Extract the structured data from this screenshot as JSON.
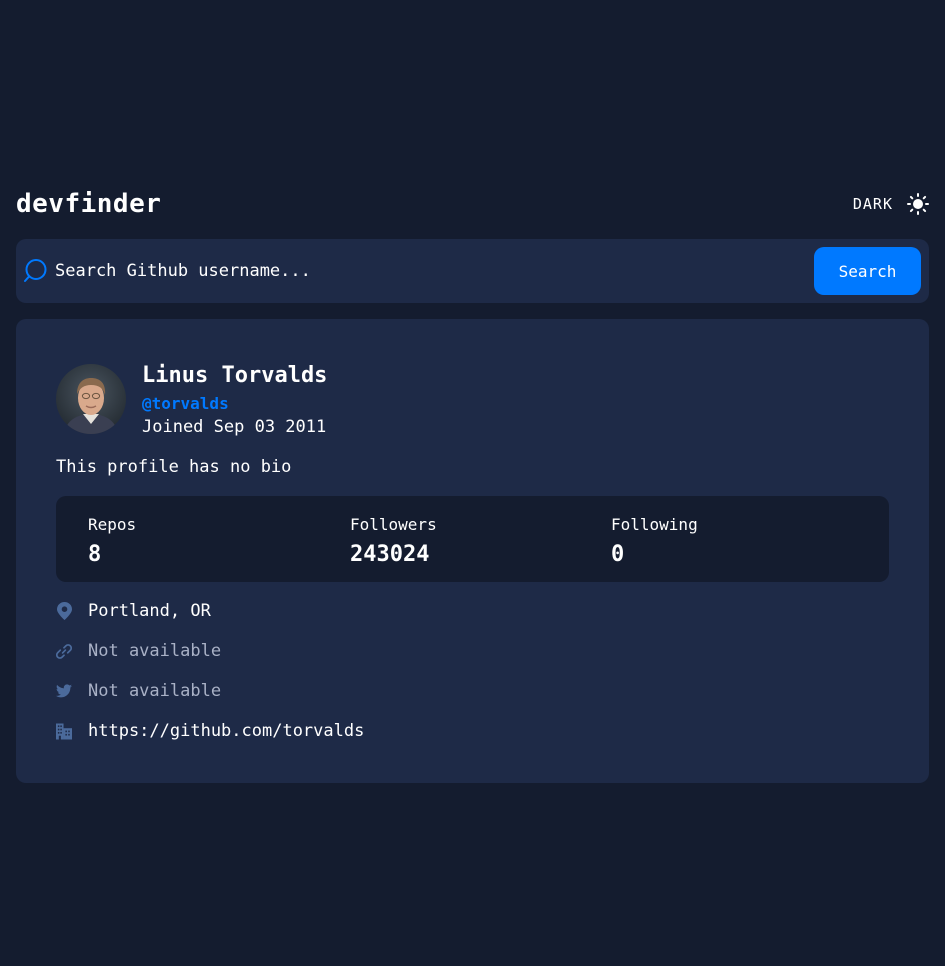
{
  "header": {
    "logo": "devfinder",
    "theme_label": "DARK",
    "theme_icon": "sun-icon"
  },
  "search": {
    "placeholder": "Search Github username...",
    "button_label": "Search",
    "icon": "search-icon"
  },
  "profile": {
    "name": "Linus Torvalds",
    "login": "@torvalds",
    "joined": "Joined Sep 03 2011",
    "bio": "This profile has no bio",
    "stats": [
      {
        "label": "Repos",
        "value": "8"
      },
      {
        "label": "Followers",
        "value": "243024"
      },
      {
        "label": "Following",
        "value": "0"
      }
    ],
    "links": {
      "location": "Portland, OR",
      "website": "Not available",
      "twitter": "Not available",
      "company": "https://github.com/torvalds"
    }
  },
  "colors": {
    "background": "#141c2f",
    "card": "#1e2a47",
    "accent": "#0079ff",
    "text": "#ffffff",
    "muted": "#a9b1c6",
    "icon": "#4b6a9b"
  }
}
